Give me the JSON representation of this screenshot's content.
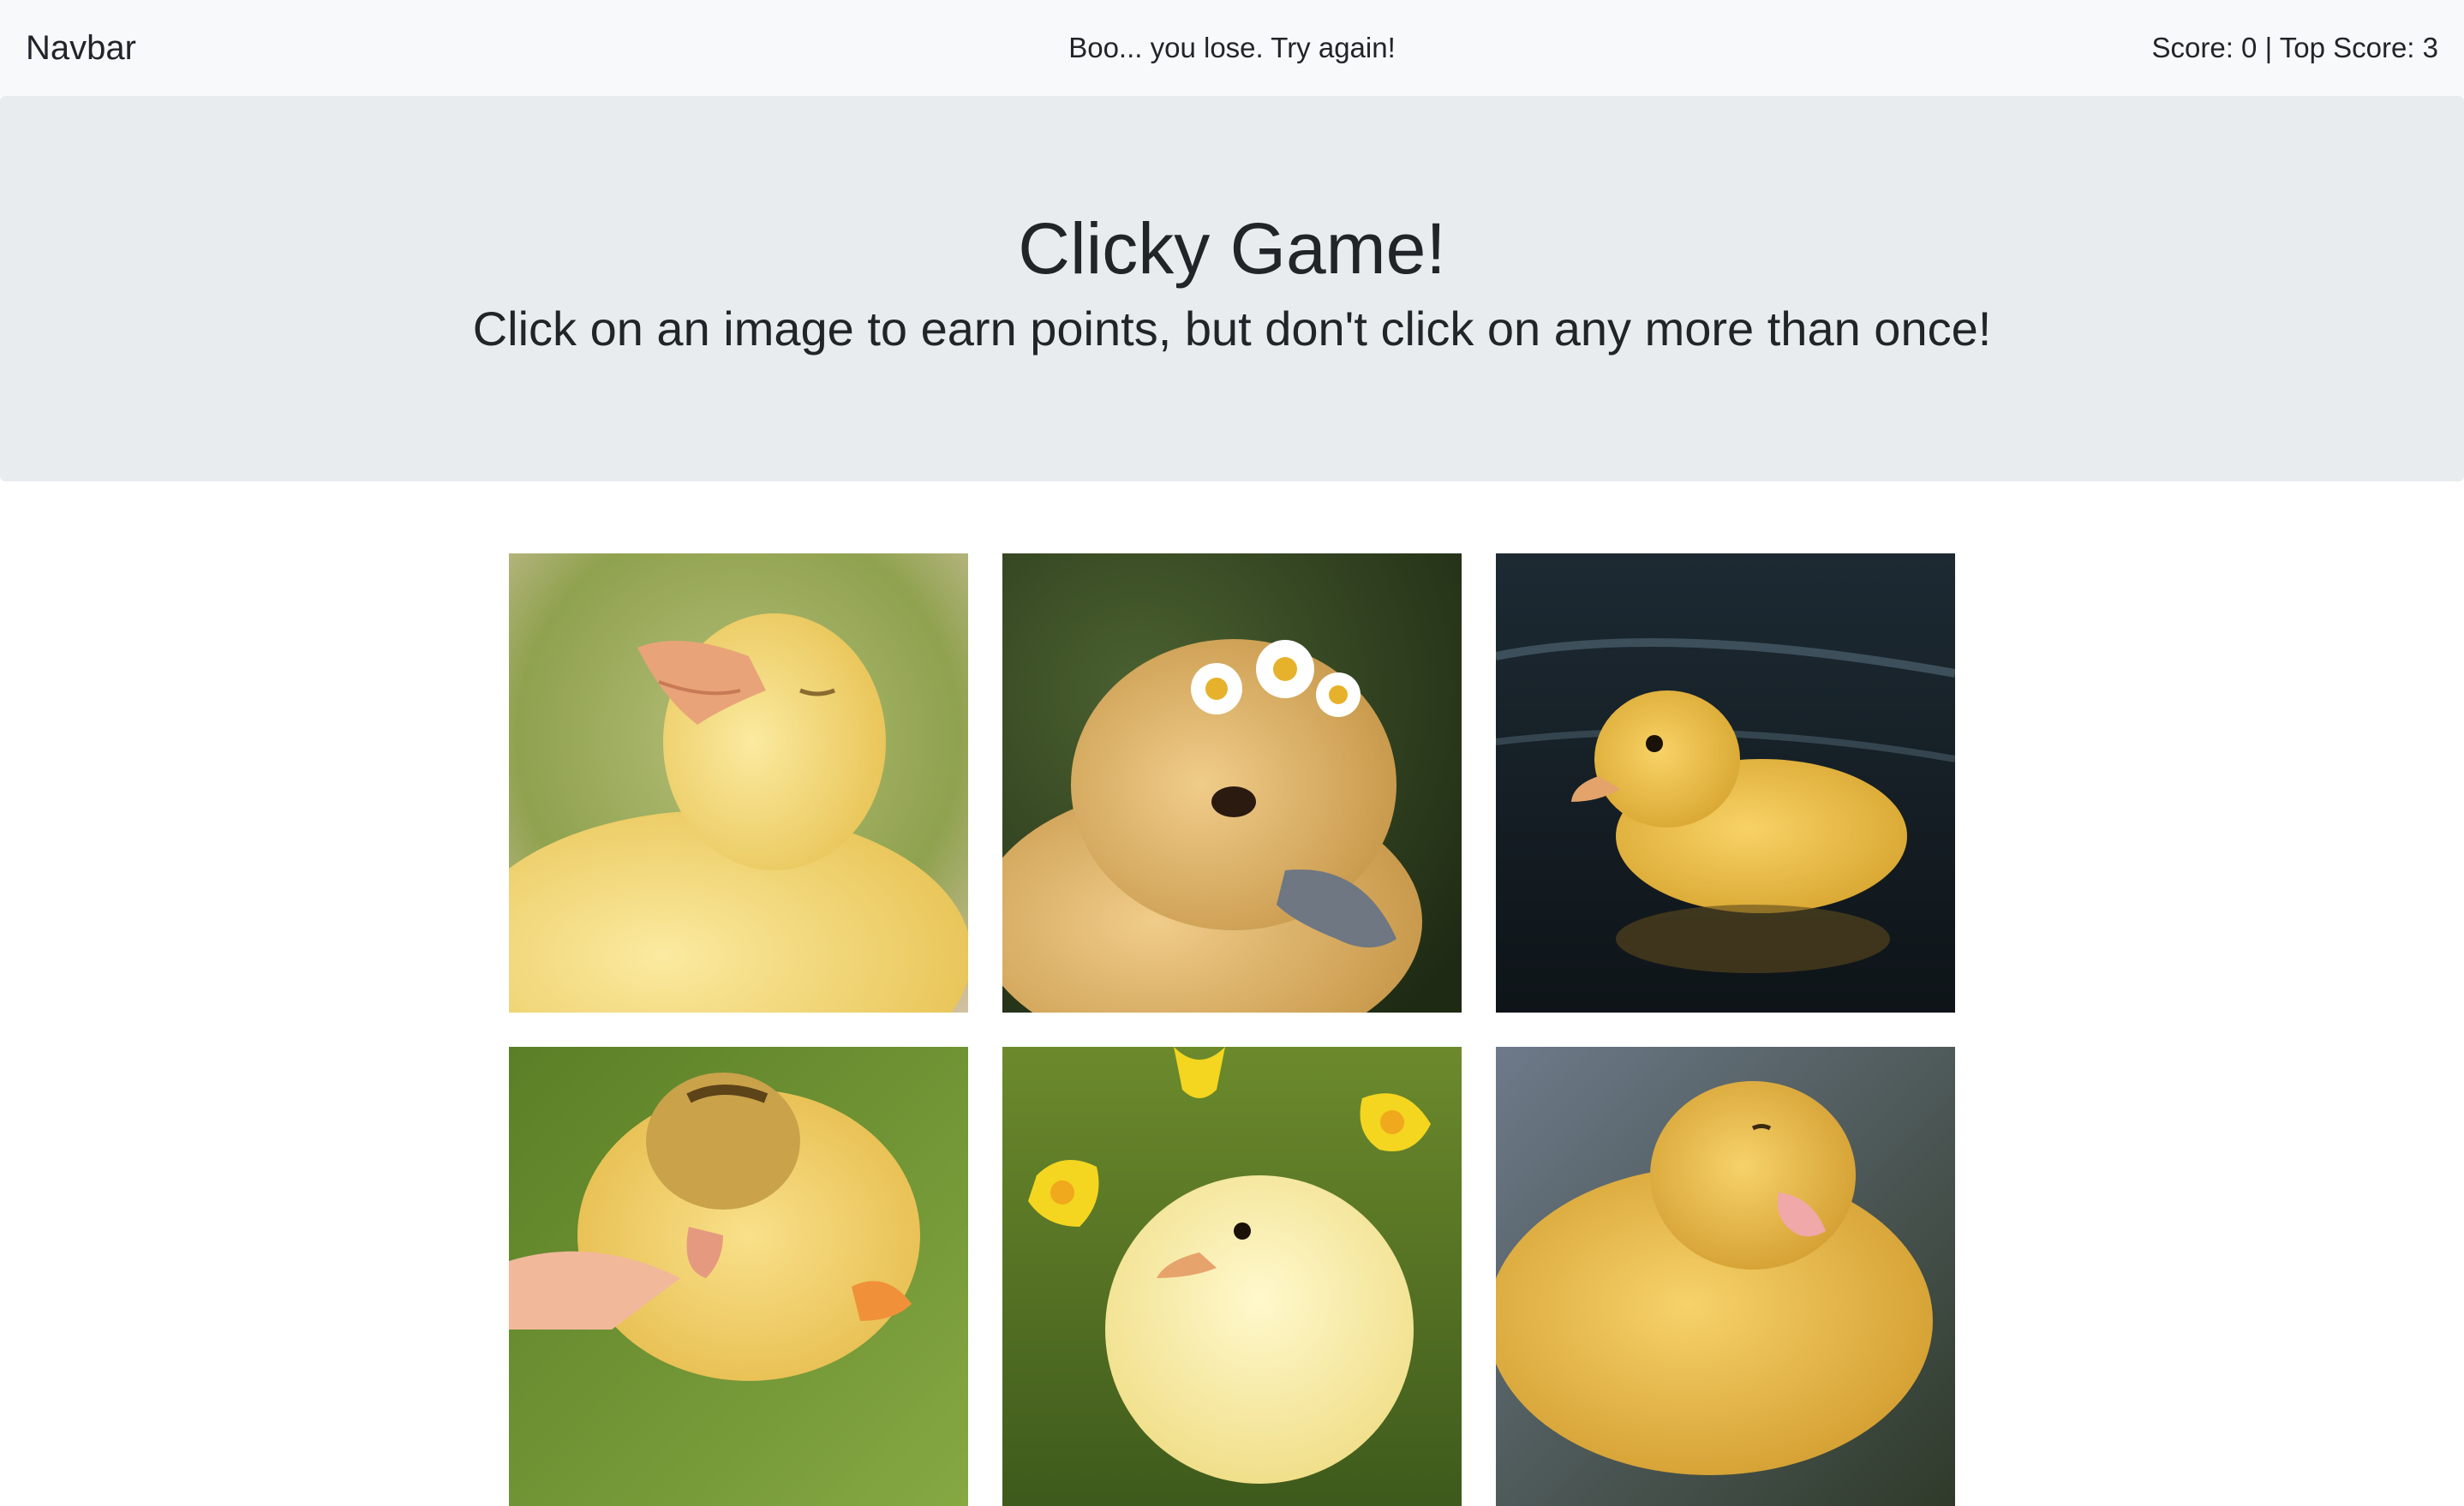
{
  "navbar": {
    "brand": "Navbar",
    "message": "Boo... you lose. Try again!",
    "score_text": "Score: 0 | Top Score: 3"
  },
  "jumbotron": {
    "title": "Clicky Game!",
    "subtitle": "Click on an image to earn points, but don't click on any more than once!"
  },
  "images": [
    {
      "name": "duckling-head-up-image",
      "scene": "green-bokeh"
    },
    {
      "name": "duckling-daisy-crown-image",
      "scene": "dark-foliage"
    },
    {
      "name": "duckling-swimming-image",
      "scene": "dark-water"
    },
    {
      "name": "duckling-on-hand-image",
      "scene": "green-grass"
    },
    {
      "name": "chick-daffodils-image",
      "scene": "daffodils"
    },
    {
      "name": "duckling-pink-beak-image",
      "scene": "blue-grey-wall"
    }
  ],
  "colors": {
    "navbar_bg": "#f8f9fa",
    "jumbotron_bg": "#e9ecef",
    "text": "#212529",
    "duckling_yellow": "#f2cf5b",
    "beak_orange": "#e8a070"
  }
}
